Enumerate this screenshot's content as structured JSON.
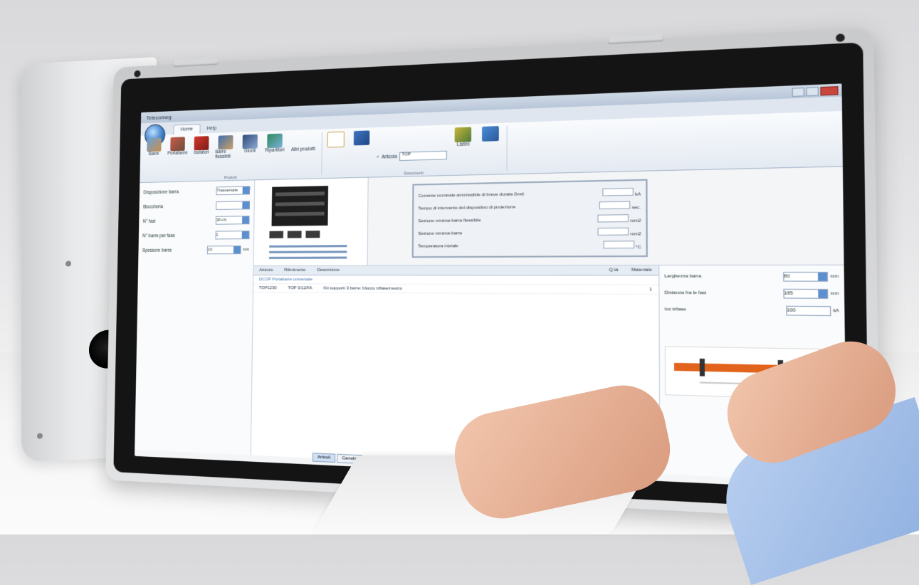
{
  "window": {
    "title": "Telecomeg"
  },
  "ribbon": {
    "tabs": [
      "Home",
      "Help"
    ],
    "products_group": {
      "label": "Prodotti",
      "buttons": [
        "Barre",
        "Portabarre",
        "Isolatori",
        "Barre flessibili",
        "Giunti",
        "Ripartitori",
        "Altri prodotti"
      ]
    },
    "documents_group": {
      "label": "Documenti",
      "search_label": "Articolo",
      "search_value": "TOP",
      "list_button": "Listini"
    }
  },
  "left_panel": {
    "fields": [
      {
        "label": "Disposizione barra",
        "value": "Trasversale"
      },
      {
        "label": "Bloccheria",
        "value": ""
      },
      {
        "label": "N° fasi",
        "value": "3F+N"
      },
      {
        "label": "N° barre per fase",
        "value": "1"
      },
      {
        "label": "Spessore barra",
        "value": "10",
        "unit": "mm"
      }
    ]
  },
  "dialog": {
    "rows": [
      {
        "label": "Corrente nominale ammissibile di breve durata (Icw)",
        "value": "",
        "unit": "kA"
      },
      {
        "label": "Tempo di intervento del dispositivo di protezione",
        "value": "",
        "unit": "sec."
      },
      {
        "label": "Sezione minima barra flessibile",
        "value": "",
        "unit": "mm2"
      },
      {
        "label": "Sezione minima barra",
        "value": "",
        "unit": "mm2"
      },
      {
        "label": "Temperatura iniziale",
        "value": "",
        "unit": "°C"
      }
    ]
  },
  "grid": {
    "columns": [
      "Articolo",
      "Riferimento",
      "Descrizione",
      "Q.tà",
      "Materiale"
    ],
    "group_label": "DCOP Portabarre universale",
    "rows": [
      {
        "articolo": "TOP1230",
        "riferimento": "TOP 3/12/FA",
        "descrizione": "Kit supporti 3 barre: blocco trifase/neutro",
        "qta": "1"
      }
    ]
  },
  "right_panel": {
    "fields": [
      {
        "label": "Larghezza barra",
        "value": "80",
        "unit": "mm"
      },
      {
        "label": "Distanza fra le fasi",
        "value": "185",
        "unit": "mm"
      },
      {
        "label": "Icc trifase",
        "value": "100",
        "unit": "kA"
      }
    ]
  },
  "bottom_tabs": [
    "Articoli",
    "Carrello"
  ],
  "colors": {
    "accent": "#3c7fc8",
    "diagram_bar": "#e2631c"
  }
}
